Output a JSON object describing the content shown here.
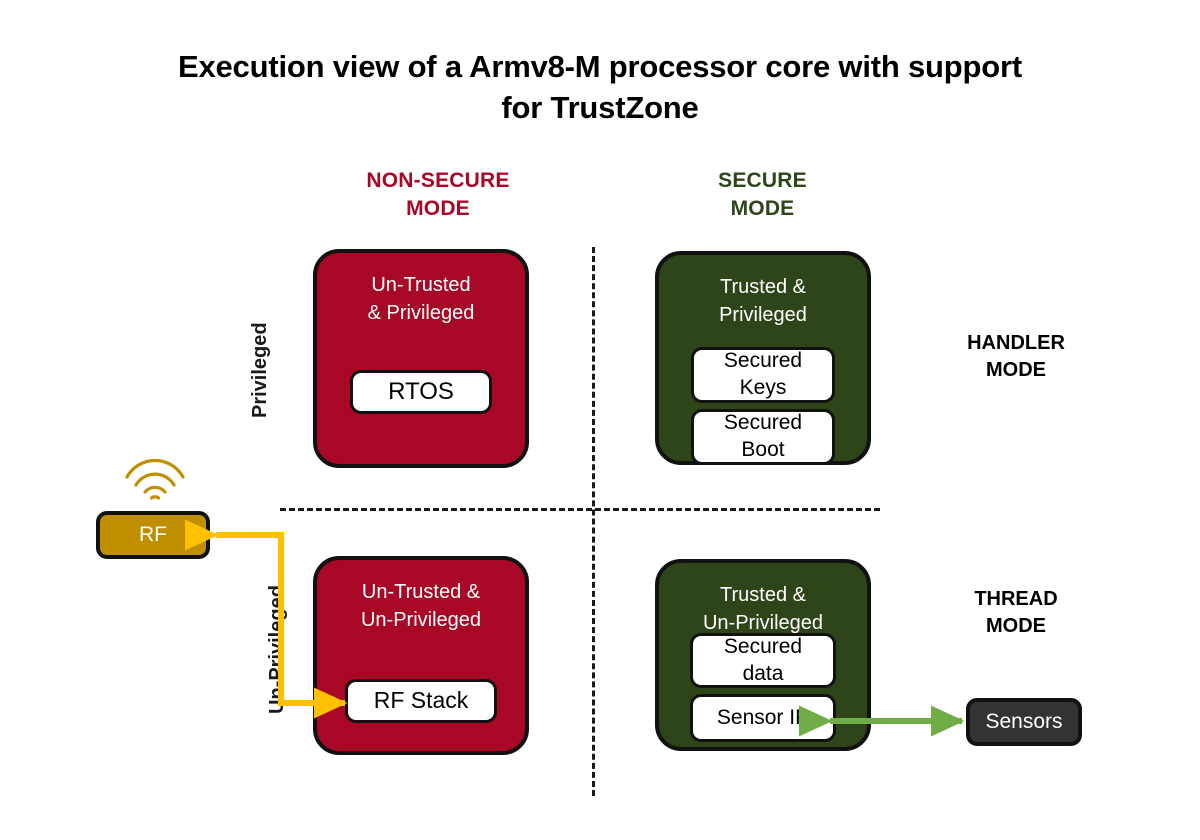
{
  "title": "Execution view of a Armv8-M processor core with support for TrustZone",
  "colors": {
    "nonsecure_red": "#A80826",
    "secure_green": "#2E4419",
    "rf_gold": "#BF8F00",
    "sensors_dark": "#333333",
    "arrow_gold": "#FFC000",
    "arrow_green": "#70AD47",
    "outline_black": "#111111"
  },
  "columns": {
    "nonsecure": "NON-SECURE\nMODE",
    "secure": "SECURE\nMODE"
  },
  "rows": {
    "privileged": "Privileged",
    "unprivileged": "Un-Privileged"
  },
  "modes": {
    "handler": "HANDLER\nMODE",
    "thread": "THREAD\nMODE"
  },
  "zones": {
    "nonsecure_privileged": {
      "title": "Un-Trusted\n& Privileged",
      "components": [
        "RTOS"
      ]
    },
    "secure_privileged": {
      "title": "Trusted &\nPrivileged",
      "components": [
        "Secured\nKeys",
        "Secured\nBoot"
      ]
    },
    "nonsecure_unprivileged": {
      "title": "Un-Trusted &\nUn-Privileged",
      "components": [
        "RF Stack"
      ]
    },
    "secure_unprivileged": {
      "title": "Trusted &\nUn-Privileged",
      "components": [
        "Secured\ndata",
        "Sensor IP"
      ]
    }
  },
  "peripherals": {
    "rf": "RF",
    "sensors": "Sensors"
  },
  "icons": {
    "antenna": "antenna-waves-icon"
  }
}
